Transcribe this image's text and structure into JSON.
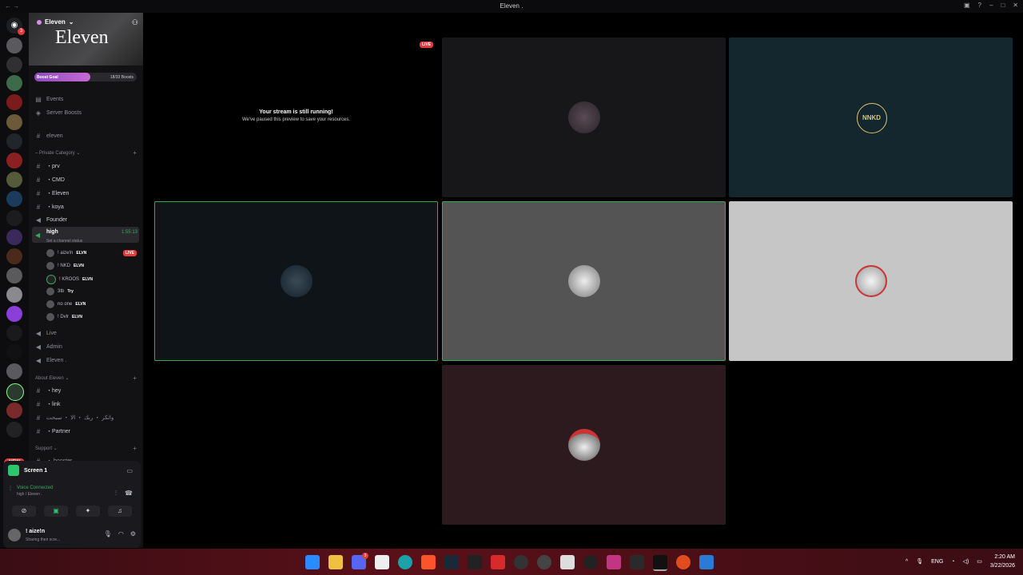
{
  "window": {
    "title": "Eleven ."
  },
  "server": {
    "name": "Eleven",
    "banner_text": "Eleven",
    "boost_label": "Boost Goal",
    "boost_count": "18/33 Boosts",
    "boost_progress": 0.55
  },
  "sidebar": {
    "top_links": [
      "Events",
      "Server Boosts"
    ],
    "channel_eleven": "eleven",
    "category_private": "Private Category",
    "private_channels": [
      "・prv",
      "・CMD",
      "・Eleven",
      "・koya"
    ],
    "founder": "Founder",
    "active_voice": {
      "name": "high",
      "status": "Set a channel status",
      "time": "1:55:13"
    },
    "voice_users": [
      {
        "name": "! aize!n",
        "tag": "ELVN",
        "live": "LIVE"
      },
      {
        "name": "! NKD",
        "tag": "ELVN"
      },
      {
        "name": "! KROOS",
        "tag": "ELVN"
      },
      {
        "name": "3tb",
        "tag": "Try"
      },
      {
        "name": "no one",
        "tag": "ELVN"
      },
      {
        "name": "! Dvlr",
        "tag": "ELVN"
      }
    ],
    "voice_channels": [
      "Live",
      "Admin",
      "Eleven ."
    ],
    "category_about": "About Eleven",
    "about_channels": [
      "・hey",
      "・link",
      "واتكر ・ ربك ・ الا ・ سبحت",
      "・Partner"
    ],
    "category_support": "Support",
    "support_partial": "・ booster"
  },
  "screen_panel": {
    "title": "Screen 1",
    "voice_connected": "Voice Connected",
    "voice_location": "high / Eleven .",
    "user_name": "! aize!n",
    "user_status": "Sharing their scre..."
  },
  "stage": {
    "stream_title": "Your stream is still running!",
    "stream_sub": "We've paused this preview to save your resources.",
    "live_label": "LIVE",
    "nnkd_logo": "NNKD"
  },
  "rail": {
    "new_label": "NEW",
    "dm_badge": "3"
  },
  "taskbar": {
    "language": "ENG",
    "time": "2:20 AM",
    "date": "3/22/2026",
    "discord_badge": "3"
  },
  "colors": {
    "accent_green": "#3ba55d",
    "live_red": "#e03c3c",
    "boost_purple": "#b45fd0"
  }
}
